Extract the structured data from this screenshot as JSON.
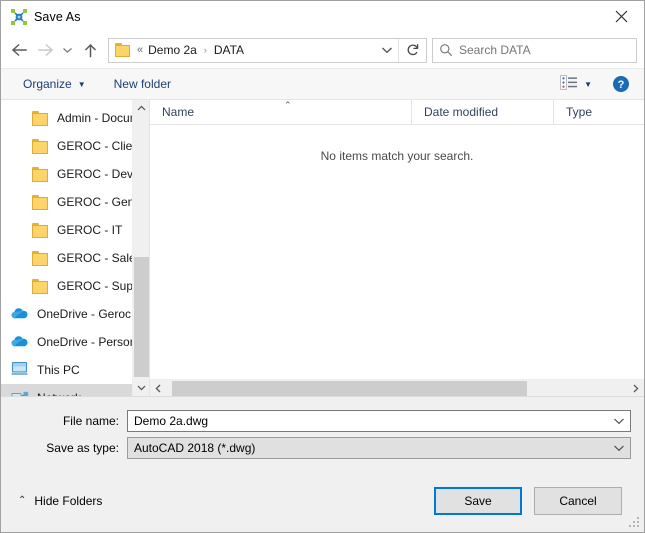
{
  "window": {
    "title": "Save As",
    "app_icon": "autocad-icon",
    "close_label": "✕"
  },
  "nav": {
    "back_icon": "arrow-left-icon",
    "forward_icon": "arrow-right-icon",
    "recent_icon": "chevron-down-icon",
    "up_icon": "arrow-up-icon",
    "refresh_icon": "refresh-icon",
    "address": {
      "folder_icon": "folder-icon",
      "overflow": "«",
      "crumbs": [
        "Demo 2a",
        "DATA"
      ],
      "separator": "›",
      "dropdown_icon": "chevron-down-icon"
    },
    "search": {
      "icon": "search-icon",
      "placeholder": "Search DATA",
      "value": ""
    }
  },
  "toolbar": {
    "organize_label": "Organize",
    "organize_caret": "▼",
    "new_folder_label": "New folder",
    "view_icon": "view-layout-icon",
    "view_caret": "▼",
    "help_icon": "help-icon",
    "help_glyph": "?"
  },
  "navpane": {
    "items": [
      {
        "label": "Admin - Docum",
        "icon": "folder-icon",
        "type": "folder",
        "indent": true,
        "selected": false
      },
      {
        "label": "GEROC - Clients",
        "icon": "folder-icon",
        "type": "folder",
        "indent": true,
        "selected": false
      },
      {
        "label": "GEROC - Develo",
        "icon": "folder-icon",
        "type": "folder",
        "indent": true,
        "selected": false
      },
      {
        "label": "GEROC - Genera",
        "icon": "folder-icon",
        "type": "folder",
        "indent": true,
        "selected": false
      },
      {
        "label": "GEROC - IT",
        "icon": "folder-icon",
        "type": "folder",
        "indent": true,
        "selected": false
      },
      {
        "label": "GEROC - Sales",
        "icon": "folder-icon",
        "type": "folder",
        "indent": true,
        "selected": false
      },
      {
        "label": "GEROC - Suppor",
        "icon": "folder-icon",
        "type": "folder",
        "indent": true,
        "selected": false
      },
      {
        "label": "OneDrive - Geroc",
        "icon": "onedrive-cloud-icon",
        "type": "cloud",
        "indent": false,
        "selected": false
      },
      {
        "label": "OneDrive - Person",
        "icon": "onedrive-cloud-icon",
        "type": "cloud",
        "indent": false,
        "selected": false
      },
      {
        "label": "This PC",
        "icon": "this-pc-icon",
        "type": "pc",
        "indent": false,
        "selected": false
      },
      {
        "label": "Network",
        "icon": "network-icon",
        "type": "network",
        "indent": false,
        "selected": true
      }
    ],
    "scroll_up_icon": "chevron-up-icon",
    "scroll_down_icon": "chevron-down-icon"
  },
  "filelist": {
    "columns": [
      {
        "label": "Name",
        "sorted": true,
        "sort_caret": "⌃"
      },
      {
        "label": "Date modified",
        "sorted": false
      },
      {
        "label": "Type",
        "sorted": false
      }
    ],
    "empty_message": "No items match your search.",
    "rows": [],
    "scroll_left_icon": "chevron-left-icon",
    "scroll_right_icon": "chevron-right-icon"
  },
  "footer": {
    "file_name_label": "File name:",
    "file_name_value": "Demo 2a.dwg",
    "file_name_dropdown_icon": "chevron-down-icon",
    "save_as_type_label": "Save as type:",
    "save_as_type_value": "AutoCAD 2018 (*.dwg)",
    "save_as_type_dropdown_icon": "chevron-down-icon",
    "hide_folders_label": "Hide Folders",
    "hide_folders_caret": "⌃",
    "save_label": "Save",
    "cancel_label": "Cancel"
  },
  "colors": {
    "accent": "#0078d7",
    "folder_yellow": "#fcd469",
    "toolbar_link": "#1d3f73",
    "selection_gray": "#d9d9d9",
    "footer_bg": "#f0f0f0"
  }
}
